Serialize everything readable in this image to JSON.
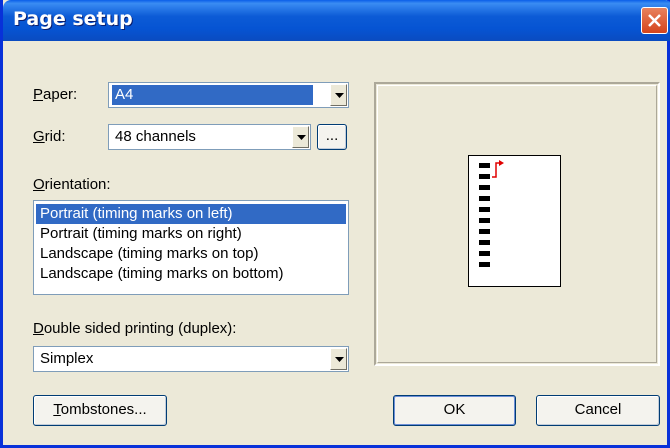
{
  "window": {
    "title": "Page setup"
  },
  "paper": {
    "label_prefix": "",
    "label_mnemonic": "P",
    "label_rest": "aper:",
    "value": "A4"
  },
  "grid": {
    "label_mnemonic": "G",
    "label_rest": "rid:",
    "value": "48 channels",
    "browse_label": "..."
  },
  "orientation": {
    "label_mnemonic": "O",
    "label_rest": "rientation:",
    "items": [
      "Portrait (timing marks on left)",
      "Portrait (timing marks on right)",
      "Landscape (timing marks on top)",
      "Landscape (timing marks on bottom)"
    ],
    "selected_index": 0
  },
  "duplex": {
    "label_mnemonic": "D",
    "label_rest": "ouble sided printing (duplex):",
    "value": "Simplex"
  },
  "buttons": {
    "tombstones_mnemonic": "T",
    "tombstones_rest": "ombstones...",
    "ok": "OK",
    "cancel": "Cancel"
  },
  "preview": {
    "timing_marks": 10,
    "arrow_color": "#e00000"
  },
  "colors": {
    "selection": "#316ac5",
    "titlebar": "#0654d3",
    "dialog_bg": "#ece9d8"
  }
}
